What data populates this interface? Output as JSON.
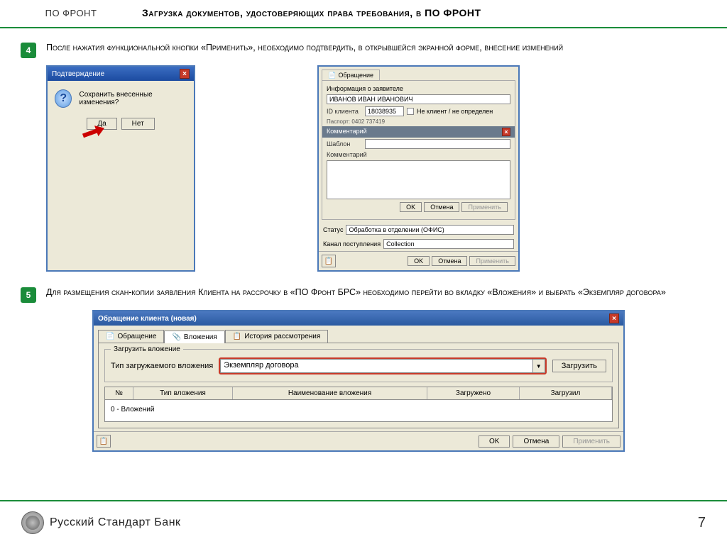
{
  "header": {
    "left": "ПО ФРОНТ",
    "title": "Загрузка документов, удостоверяющих права требования, в ПО ФРОНТ"
  },
  "step4": {
    "num": "4",
    "text": "После нажатия функциональной кнопки «Применить», необходимо подтвердить, в открывшейся экранной форме, внесение изменений",
    "confirm": {
      "title": "Подтверждение",
      "msg": "Сохранить внесенные изменения?",
      "yes": "Да",
      "no": "Нет"
    },
    "big": {
      "tab": "Обращение",
      "info_label": "Информация о заявителе",
      "name": "ИВАНОВ ИВАН ИВАНОВИЧ",
      "id_label": "ID клиента",
      "id": "18038935",
      "chk_label": "Не клиент / не определен",
      "pass_label": "Паспорт: 0402 737419",
      "comment_hdr": "Комментарий",
      "tpl_label": "Шаблон",
      "cmt_label": "Комментарий",
      "ok": "OK",
      "cancel": "Отмена",
      "apply": "Применить",
      "status_label": "Статус",
      "status": "Обработка в отделении (ОФИС)",
      "channel_label": "Канал поступления",
      "channel": "Collection"
    }
  },
  "step5": {
    "num": "5",
    "text": "Для размещения скан-копии заявления Клиента на рассрочку в «ПО Фронт БРС» необходимо перейти во вкладку «Вложения»  и выбрать «Экземпляр договора»",
    "title": "Обращение клиента (новая)",
    "tabs": {
      "t1": "Обращение",
      "t2": "Вложения",
      "t3": "История рассмотрения"
    },
    "fieldset_label": "Загрузить вложение",
    "type_label": "Тип загружаемого вложения",
    "combo_value": "Экземпляр договора",
    "load_btn": "Загрузить",
    "cols": {
      "c1": "№",
      "c2": "Тип вложения",
      "c3": "Наименование вложения",
      "c4": "Загружено",
      "c5": "Загрузил"
    },
    "row_empty": "0 - Вложений",
    "ok": "OK",
    "cancel": "Отмена",
    "apply": "Применить"
  },
  "footer": {
    "bank": "Русский Стандарт Банк",
    "page": "7"
  }
}
